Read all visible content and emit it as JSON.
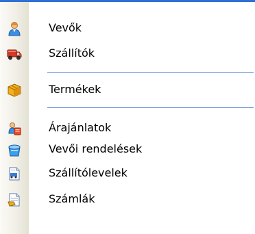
{
  "menu": {
    "items": [
      {
        "label": "Vevők",
        "icon": "person-icon"
      },
      {
        "label": "Szállítók",
        "icon": "truck-icon"
      },
      {
        "label": "Termékek",
        "icon": "box-icon"
      },
      {
        "label": "Árajánlatok",
        "icon": "quote-icon"
      },
      {
        "label": "Vevői rendelések",
        "icon": "order-icon"
      },
      {
        "label": "Szállítólevelek",
        "icon": "delivery-note-icon"
      },
      {
        "label": "Számlák",
        "icon": "invoice-icon"
      }
    ]
  }
}
